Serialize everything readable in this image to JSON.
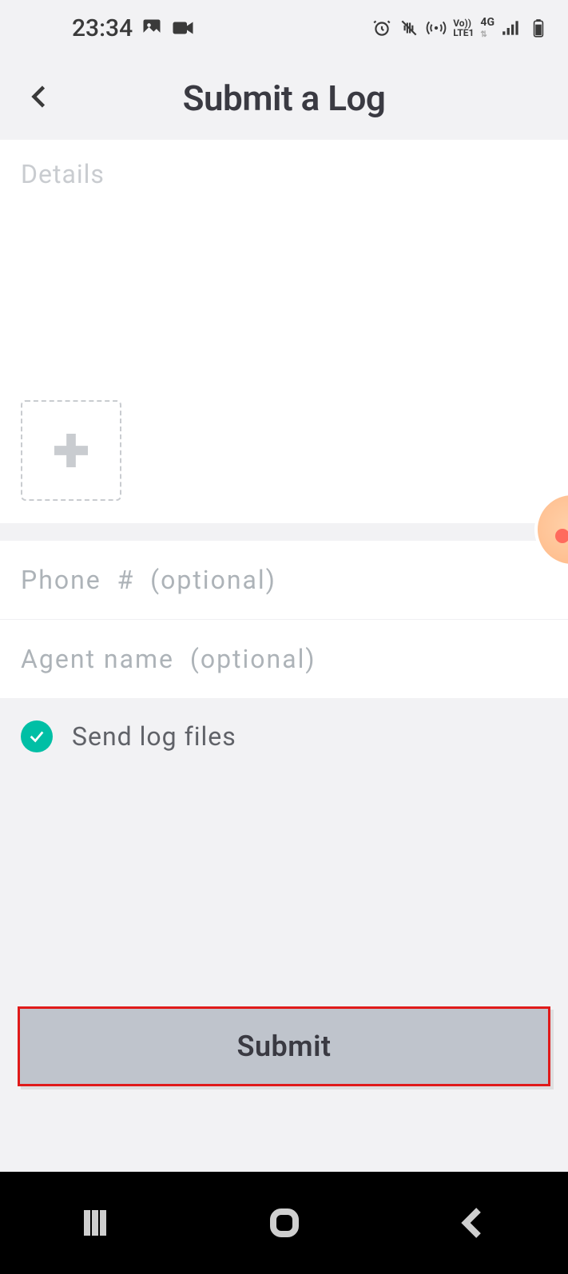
{
  "statusbar": {
    "time": "23:34"
  },
  "header": {
    "title": "Submit a Log"
  },
  "form": {
    "details_placeholder": "Details",
    "phone_placeholder": "Phone  #  (optional)",
    "agent_placeholder": "Agent name  (optional)",
    "send_logs_label": "Send log files",
    "submit_label": "Submit"
  }
}
